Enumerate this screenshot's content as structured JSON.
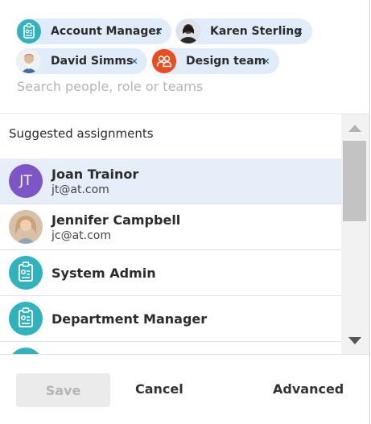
{
  "selected": [
    {
      "label": "Account Manager",
      "icon": "role-badge-icon"
    },
    {
      "label": "Karen Sterling",
      "icon": "user-photo"
    },
    {
      "label": "David Simms",
      "icon": "user-photo"
    },
    {
      "label": "Design team",
      "icon": "team-icon"
    }
  ],
  "search": {
    "placeholder": "Search people, role or teams"
  },
  "suggestions": {
    "heading": "Suggested assignments",
    "items": [
      {
        "name": "Joan Trainor",
        "email": "jt@at.com",
        "initials": "JT"
      },
      {
        "name": "Jennifer Campbell",
        "email": "jc@at.com"
      },
      {
        "name": "System Admin"
      },
      {
        "name": "Department Manager"
      }
    ]
  },
  "footer": {
    "save": "Save",
    "cancel": "Cancel",
    "advanced": "Advanced"
  },
  "colors": {
    "teal": "#31b2bf",
    "orange": "#ea4c1d",
    "purple": "#7e55c6",
    "chip": "#e1ecfb",
    "selected_row": "#e6eefa"
  }
}
